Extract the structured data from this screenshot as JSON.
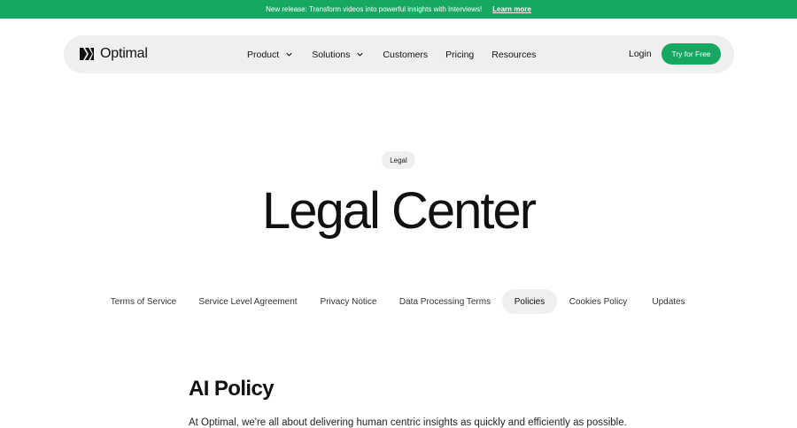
{
  "banner": {
    "text": "New release: Transform videos into powerful insights with Interviews!",
    "link": "Learn more"
  },
  "nav": {
    "brand": "Optimal",
    "items": [
      {
        "label": "Product",
        "has_dropdown": true
      },
      {
        "label": "Solutions",
        "has_dropdown": true
      },
      {
        "label": "Customers",
        "has_dropdown": false
      },
      {
        "label": "Pricing",
        "has_dropdown": false
      },
      {
        "label": "Resources",
        "has_dropdown": false
      }
    ],
    "login": "Login",
    "cta": "Try for Free"
  },
  "hero": {
    "tag": "Legal",
    "title": "Legal Center"
  },
  "tabs": [
    {
      "label": "Terms of Service",
      "active": false
    },
    {
      "label": "Service Level Agreement",
      "active": false
    },
    {
      "label": "Privacy Notice",
      "active": false
    },
    {
      "label": "Data Processing Terms",
      "active": false
    },
    {
      "label": "Policies",
      "active": true
    },
    {
      "label": "Cookies Policy",
      "active": false
    },
    {
      "label": "Updates",
      "active": false
    }
  ],
  "content": {
    "heading": "AI Policy",
    "intro": "At Optimal, we're all about delivering human centric insights as quickly and efficiently as possible."
  },
  "colors": {
    "accent": "#16a862",
    "nav_bg": "#efefef"
  }
}
